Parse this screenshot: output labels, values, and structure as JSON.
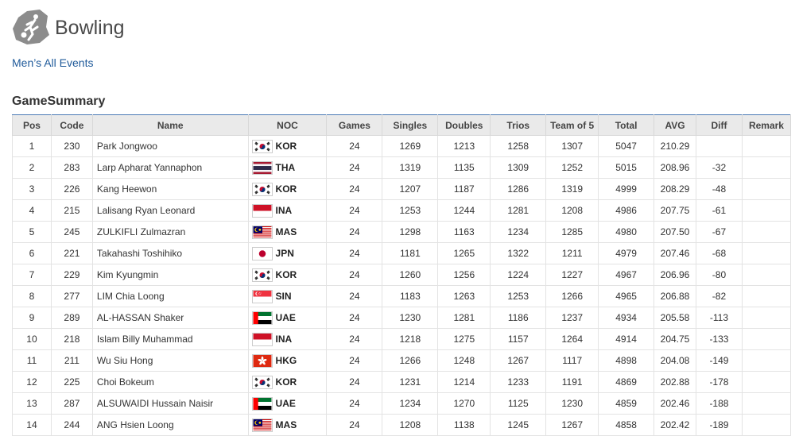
{
  "header": {
    "sport_title": "Bowling",
    "event_link": "Men’s All Events"
  },
  "section": {
    "title": "GameSummary"
  },
  "table": {
    "columns": [
      "Pos",
      "Code",
      "Name",
      "NOC",
      "Games",
      "Singles",
      "Doubles",
      "Trios",
      "Team of 5",
      "Total",
      "AVG",
      "Diff",
      "Remark"
    ],
    "rows": [
      {
        "pos": "1",
        "code": "230",
        "name": "Park Jongwoo",
        "noc": "KOR",
        "flag": "kor-flag-icon",
        "games": "24",
        "singles": "1269",
        "doubles": "1213",
        "trios": "1258",
        "team5": "1307",
        "total": "5047",
        "avg": "210.29",
        "diff": "",
        "remark": ""
      },
      {
        "pos": "2",
        "code": "283",
        "name": "Larp Apharat Yannaphon",
        "noc": "THA",
        "flag": "tha-flag-icon",
        "games": "24",
        "singles": "1319",
        "doubles": "1135",
        "trios": "1309",
        "team5": "1252",
        "total": "5015",
        "avg": "208.96",
        "diff": "-32",
        "remark": ""
      },
      {
        "pos": "3",
        "code": "226",
        "name": "Kang Heewon",
        "noc": "KOR",
        "flag": "kor-flag-icon",
        "games": "24",
        "singles": "1207",
        "doubles": "1187",
        "trios": "1286",
        "team5": "1319",
        "total": "4999",
        "avg": "208.29",
        "diff": "-48",
        "remark": ""
      },
      {
        "pos": "4",
        "code": "215",
        "name": "Lalisang Ryan Leonard",
        "noc": "INA",
        "flag": "ina-flag-icon",
        "games": "24",
        "singles": "1253",
        "doubles": "1244",
        "trios": "1281",
        "team5": "1208",
        "total": "4986",
        "avg": "207.75",
        "diff": "-61",
        "remark": ""
      },
      {
        "pos": "5",
        "code": "245",
        "name": "ZULKIFLI Zulmazran",
        "noc": "MAS",
        "flag": "mas-flag-icon",
        "games": "24",
        "singles": "1298",
        "doubles": "1163",
        "trios": "1234",
        "team5": "1285",
        "total": "4980",
        "avg": "207.50",
        "diff": "-67",
        "remark": ""
      },
      {
        "pos": "6",
        "code": "221",
        "name": "Takahashi Toshihiko",
        "noc": "JPN",
        "flag": "jpn-flag-icon",
        "games": "24",
        "singles": "1181",
        "doubles": "1265",
        "trios": "1322",
        "team5": "1211",
        "total": "4979",
        "avg": "207.46",
        "diff": "-68",
        "remark": ""
      },
      {
        "pos": "7",
        "code": "229",
        "name": "Kim Kyungmin",
        "noc": "KOR",
        "flag": "kor-flag-icon",
        "games": "24",
        "singles": "1260",
        "doubles": "1256",
        "trios": "1224",
        "team5": "1227",
        "total": "4967",
        "avg": "206.96",
        "diff": "-80",
        "remark": ""
      },
      {
        "pos": "8",
        "code": "277",
        "name": "LIM Chia Loong",
        "noc": "SIN",
        "flag": "sin-flag-icon",
        "games": "24",
        "singles": "1183",
        "doubles": "1263",
        "trios": "1253",
        "team5": "1266",
        "total": "4965",
        "avg": "206.88",
        "diff": "-82",
        "remark": ""
      },
      {
        "pos": "9",
        "code": "289",
        "name": "AL-HASSAN Shaker",
        "noc": "UAE",
        "flag": "uae-flag-icon",
        "games": "24",
        "singles": "1230",
        "doubles": "1281",
        "trios": "1186",
        "team5": "1237",
        "total": "4934",
        "avg": "205.58",
        "diff": "-113",
        "remark": ""
      },
      {
        "pos": "10",
        "code": "218",
        "name": "Islam Billy Muhammad",
        "noc": "INA",
        "flag": "ina-flag-icon",
        "games": "24",
        "singles": "1218",
        "doubles": "1275",
        "trios": "1157",
        "team5": "1264",
        "total": "4914",
        "avg": "204.75",
        "diff": "-133",
        "remark": ""
      },
      {
        "pos": "11",
        "code": "211",
        "name": "Wu Siu Hong",
        "noc": "HKG",
        "flag": "hkg-flag-icon",
        "games": "24",
        "singles": "1266",
        "doubles": "1248",
        "trios": "1267",
        "team5": "1117",
        "total": "4898",
        "avg": "204.08",
        "diff": "-149",
        "remark": ""
      },
      {
        "pos": "12",
        "code": "225",
        "name": "Choi Bokeum",
        "noc": "KOR",
        "flag": "kor-flag-icon",
        "games": "24",
        "singles": "1231",
        "doubles": "1214",
        "trios": "1233",
        "team5": "1191",
        "total": "4869",
        "avg": "202.88",
        "diff": "-178",
        "remark": ""
      },
      {
        "pos": "13",
        "code": "287",
        "name": "ALSUWAIDI Hussain Naisir",
        "noc": "UAE",
        "flag": "uae-flag-icon",
        "games": "24",
        "singles": "1234",
        "doubles": "1270",
        "trios": "1125",
        "team5": "1230",
        "total": "4859",
        "avg": "202.46",
        "diff": "-188",
        "remark": ""
      },
      {
        "pos": "14",
        "code": "244",
        "name": "ANG Hsien Loong",
        "noc": "MAS",
        "flag": "mas-flag-icon",
        "games": "24",
        "singles": "1208",
        "doubles": "1138",
        "trios": "1245",
        "team5": "1267",
        "total": "4858",
        "avg": "202.42",
        "diff": "-189",
        "remark": ""
      }
    ]
  },
  "colors": {
    "link": "#1f5a9a",
    "header_bg": "#eaeaea",
    "header_top_border": "#4a7ab5"
  }
}
